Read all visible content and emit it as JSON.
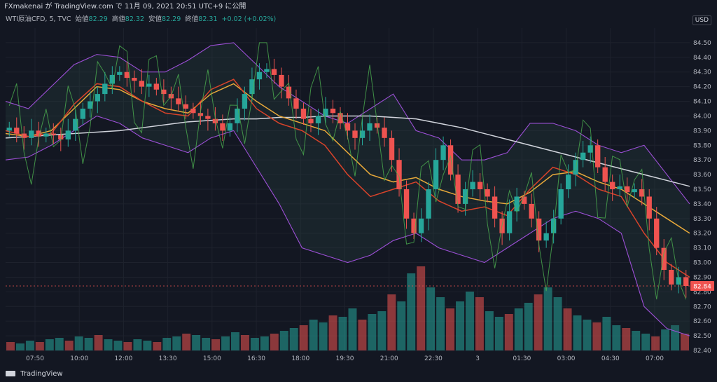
{
  "header": {
    "publisher_line": "FXmakenai が TradingView.com で 11月 09, 2021 20:51 UTC+9 に公開"
  },
  "legend": {
    "symbol": "WTI原油CFD, 5, TVC",
    "open_label": "始値",
    "open": "82.29",
    "high_label": "高値",
    "high": "82.32",
    "low_label": "安値",
    "low": "82.29",
    "close_label": "終値",
    "close": "82.31",
    "change": "+0.02 (+0.02%)"
  },
  "currency": "USD",
  "footer": {
    "brand": "TradingView"
  },
  "colors": {
    "background": "#131722",
    "up": "#26a69a",
    "down": "#ef5350",
    "ma_white": "#d1d4dc",
    "ma_orange": "#e8a93a",
    "ma_red": "#d9432a",
    "bollinger": "#9c4fd6",
    "rsi_line": "#4caf50",
    "price_tag": "#ef5350"
  },
  "chart_data": {
    "type": "candlestick",
    "ylim": [
      82.4,
      84.6
    ],
    "y_ticks": [
      "84.50",
      "84.40",
      "84.30",
      "84.20",
      "84.10",
      "84.00",
      "83.90",
      "83.80",
      "83.70",
      "83.60",
      "83.50",
      "83.40",
      "83.30",
      "83.20",
      "83.10",
      "83.00",
      "82.90",
      "82.80",
      "82.70",
      "82.60",
      "82.50",
      "82.40"
    ],
    "x_ticks": [
      "07:50",
      "10:00",
      "12:00",
      "13:30",
      "15:00",
      "16:30",
      "18:00",
      "19:30",
      "21:00",
      "22:30",
      "3",
      "01:30",
      "03:00",
      "04:30",
      "07:00"
    ],
    "last_price": "82.84",
    "closes": [
      83.92,
      83.88,
      83.85,
      83.9,
      83.86,
      83.88,
      83.87,
      83.84,
      83.9,
      83.98,
      84.05,
      84.1,
      84.15,
      84.22,
      84.28,
      84.3,
      84.26,
      84.24,
      84.2,
      84.22,
      84.18,
      84.15,
      84.12,
      84.08,
      84.05,
      84.02,
      84.0,
      83.98,
      83.95,
      83.9,
      83.95,
      84.05,
      84.15,
      84.25,
      84.3,
      84.32,
      84.28,
      84.2,
      84.12,
      84.05,
      83.98,
      83.95,
      84.0,
      84.05,
      84.02,
      83.95,
      83.9,
      83.85,
      83.9,
      83.95,
      83.92,
      83.85,
      83.7,
      83.5,
      83.3,
      83.2,
      83.3,
      83.5,
      83.7,
      83.8,
      83.6,
      83.4,
      83.5,
      83.55,
      83.5,
      83.45,
      83.3,
      83.2,
      83.35,
      83.45,
      83.4,
      83.3,
      83.15,
      83.2,
      83.3,
      83.5,
      83.6,
      83.7,
      83.75,
      83.8,
      83.65,
      83.55,
      83.5,
      83.52,
      83.48,
      83.5,
      83.45,
      83.3,
      83.1,
      82.95,
      82.85,
      82.9,
      82.84
    ],
    "series": [
      {
        "name": "MA white",
        "values": [
          83.85,
          83.86,
          83.87,
          83.88,
          83.89,
          83.9,
          83.92,
          83.94,
          83.96,
          83.97,
          83.98,
          83.98,
          83.99,
          83.99,
          84.0,
          84.0,
          84.0,
          83.99,
          83.98,
          83.95,
          83.92,
          83.88,
          83.84,
          83.8,
          83.76,
          83.72,
          83.68,
          83.64,
          83.6,
          83.56,
          83.52
        ]
      },
      {
        "name": "MA orange",
        "values": [
          83.88,
          83.86,
          83.9,
          84.05,
          84.2,
          84.18,
          84.1,
          84.05,
          84.02,
          84.15,
          84.22,
          84.1,
          84.0,
          83.95,
          83.9,
          83.75,
          83.6,
          83.55,
          83.58,
          83.5,
          83.45,
          83.42,
          83.4,
          83.48,
          83.6,
          83.62,
          83.55,
          83.5,
          83.4,
          83.3,
          83.2
        ]
      },
      {
        "name": "MA red",
        "values": [
          83.9,
          83.86,
          83.88,
          84.08,
          84.22,
          84.2,
          84.1,
          84.02,
          84.0,
          84.18,
          84.25,
          84.05,
          83.95,
          83.9,
          83.8,
          83.6,
          83.45,
          83.5,
          83.55,
          83.42,
          83.35,
          83.38,
          83.32,
          83.5,
          83.65,
          83.6,
          83.5,
          83.45,
          83.2,
          83.0,
          82.9
        ]
      }
    ],
    "bollinger_upper": [
      84.1,
      84.05,
      84.2,
      84.35,
      84.42,
      84.4,
      84.3,
      84.3,
      84.38,
      84.48,
      84.5,
      84.35,
      84.2,
      84.1,
      84.0,
      83.95,
      84.05,
      84.15,
      83.9,
      83.85,
      83.7,
      83.7,
      83.75,
      83.95,
      83.95,
      83.9,
      83.8,
      83.75,
      83.8,
      83.6,
      83.4
    ],
    "bollinger_lower": [
      83.7,
      83.72,
      83.8,
      83.9,
      84.0,
      83.95,
      83.85,
      83.8,
      83.75,
      83.85,
      83.9,
      83.65,
      83.4,
      83.1,
      83.05,
      83.0,
      83.05,
      83.15,
      83.2,
      83.1,
      83.05,
      83.0,
      83.1,
      83.2,
      83.3,
      83.35,
      83.3,
      83.2,
      82.7,
      82.55,
      82.5
    ],
    "volume": [
      6,
      5,
      7,
      6,
      8,
      9,
      7,
      10,
      9,
      11,
      8,
      7,
      6,
      8,
      7,
      6,
      9,
      10,
      12,
      11,
      9,
      8,
      10,
      13,
      11,
      9,
      10,
      12,
      14,
      16,
      18,
      22,
      20,
      25,
      24,
      30,
      22,
      26,
      28,
      40,
      35,
      55,
      60,
      45,
      38,
      30,
      35,
      42,
      38,
      28,
      24,
      26,
      30,
      34,
      40,
      45,
      38,
      30,
      25,
      22,
      20,
      24,
      18,
      16,
      14,
      12,
      10,
      15,
      18,
      12
    ]
  }
}
